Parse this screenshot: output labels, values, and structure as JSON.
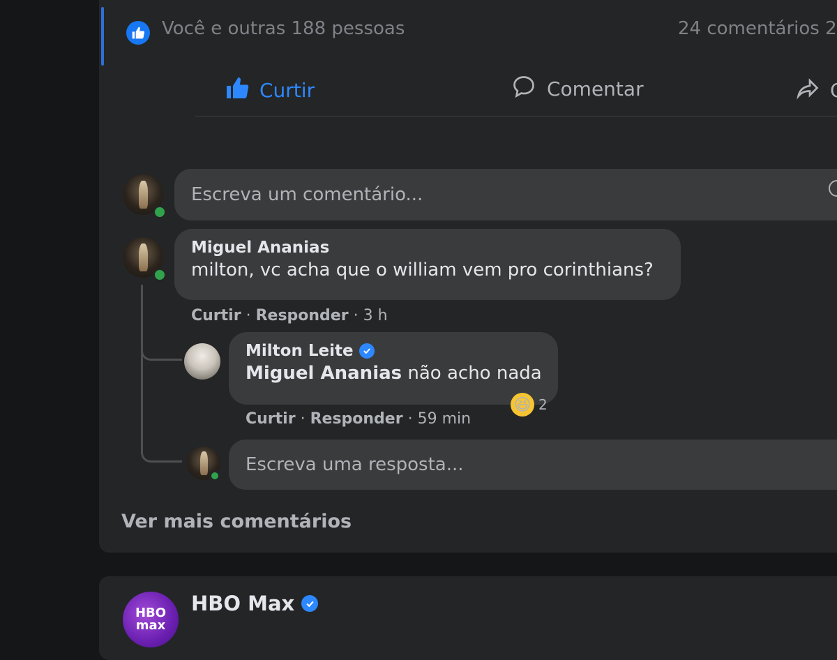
{
  "post": {
    "reactions_text": "Você e outras 188 pessoas",
    "comments_count": "24 comentários  2",
    "actions": {
      "like_label": "Curtir",
      "comment_label": "Comentar",
      "share_label": "C"
    }
  },
  "comment_box": {
    "placeholder": "Escreva um comentário..."
  },
  "comments": [
    {
      "author": "Miguel Ananias",
      "text": "milton, vc acha que o william vem pro corinthians?",
      "like_action": "Curtir",
      "reply_action": "Responder",
      "time": "3 h"
    }
  ],
  "reply": {
    "author": "Milton Leite",
    "mention": "Miguel Ananias",
    "text": " não acho nada",
    "like_action": "Curtir",
    "reply_action": "Responder",
    "time": "59 min",
    "reaction_count": "2"
  },
  "reply_box": {
    "placeholder": "Escreva uma resposta..."
  },
  "see_more": "Ver mais comentários",
  "next_post": {
    "page_name": "HBO Max",
    "logo_text": "HBO max"
  },
  "colors": {
    "accent": "#2d88ff",
    "online": "#31a24c",
    "background": "#151617",
    "card": "#242526"
  }
}
